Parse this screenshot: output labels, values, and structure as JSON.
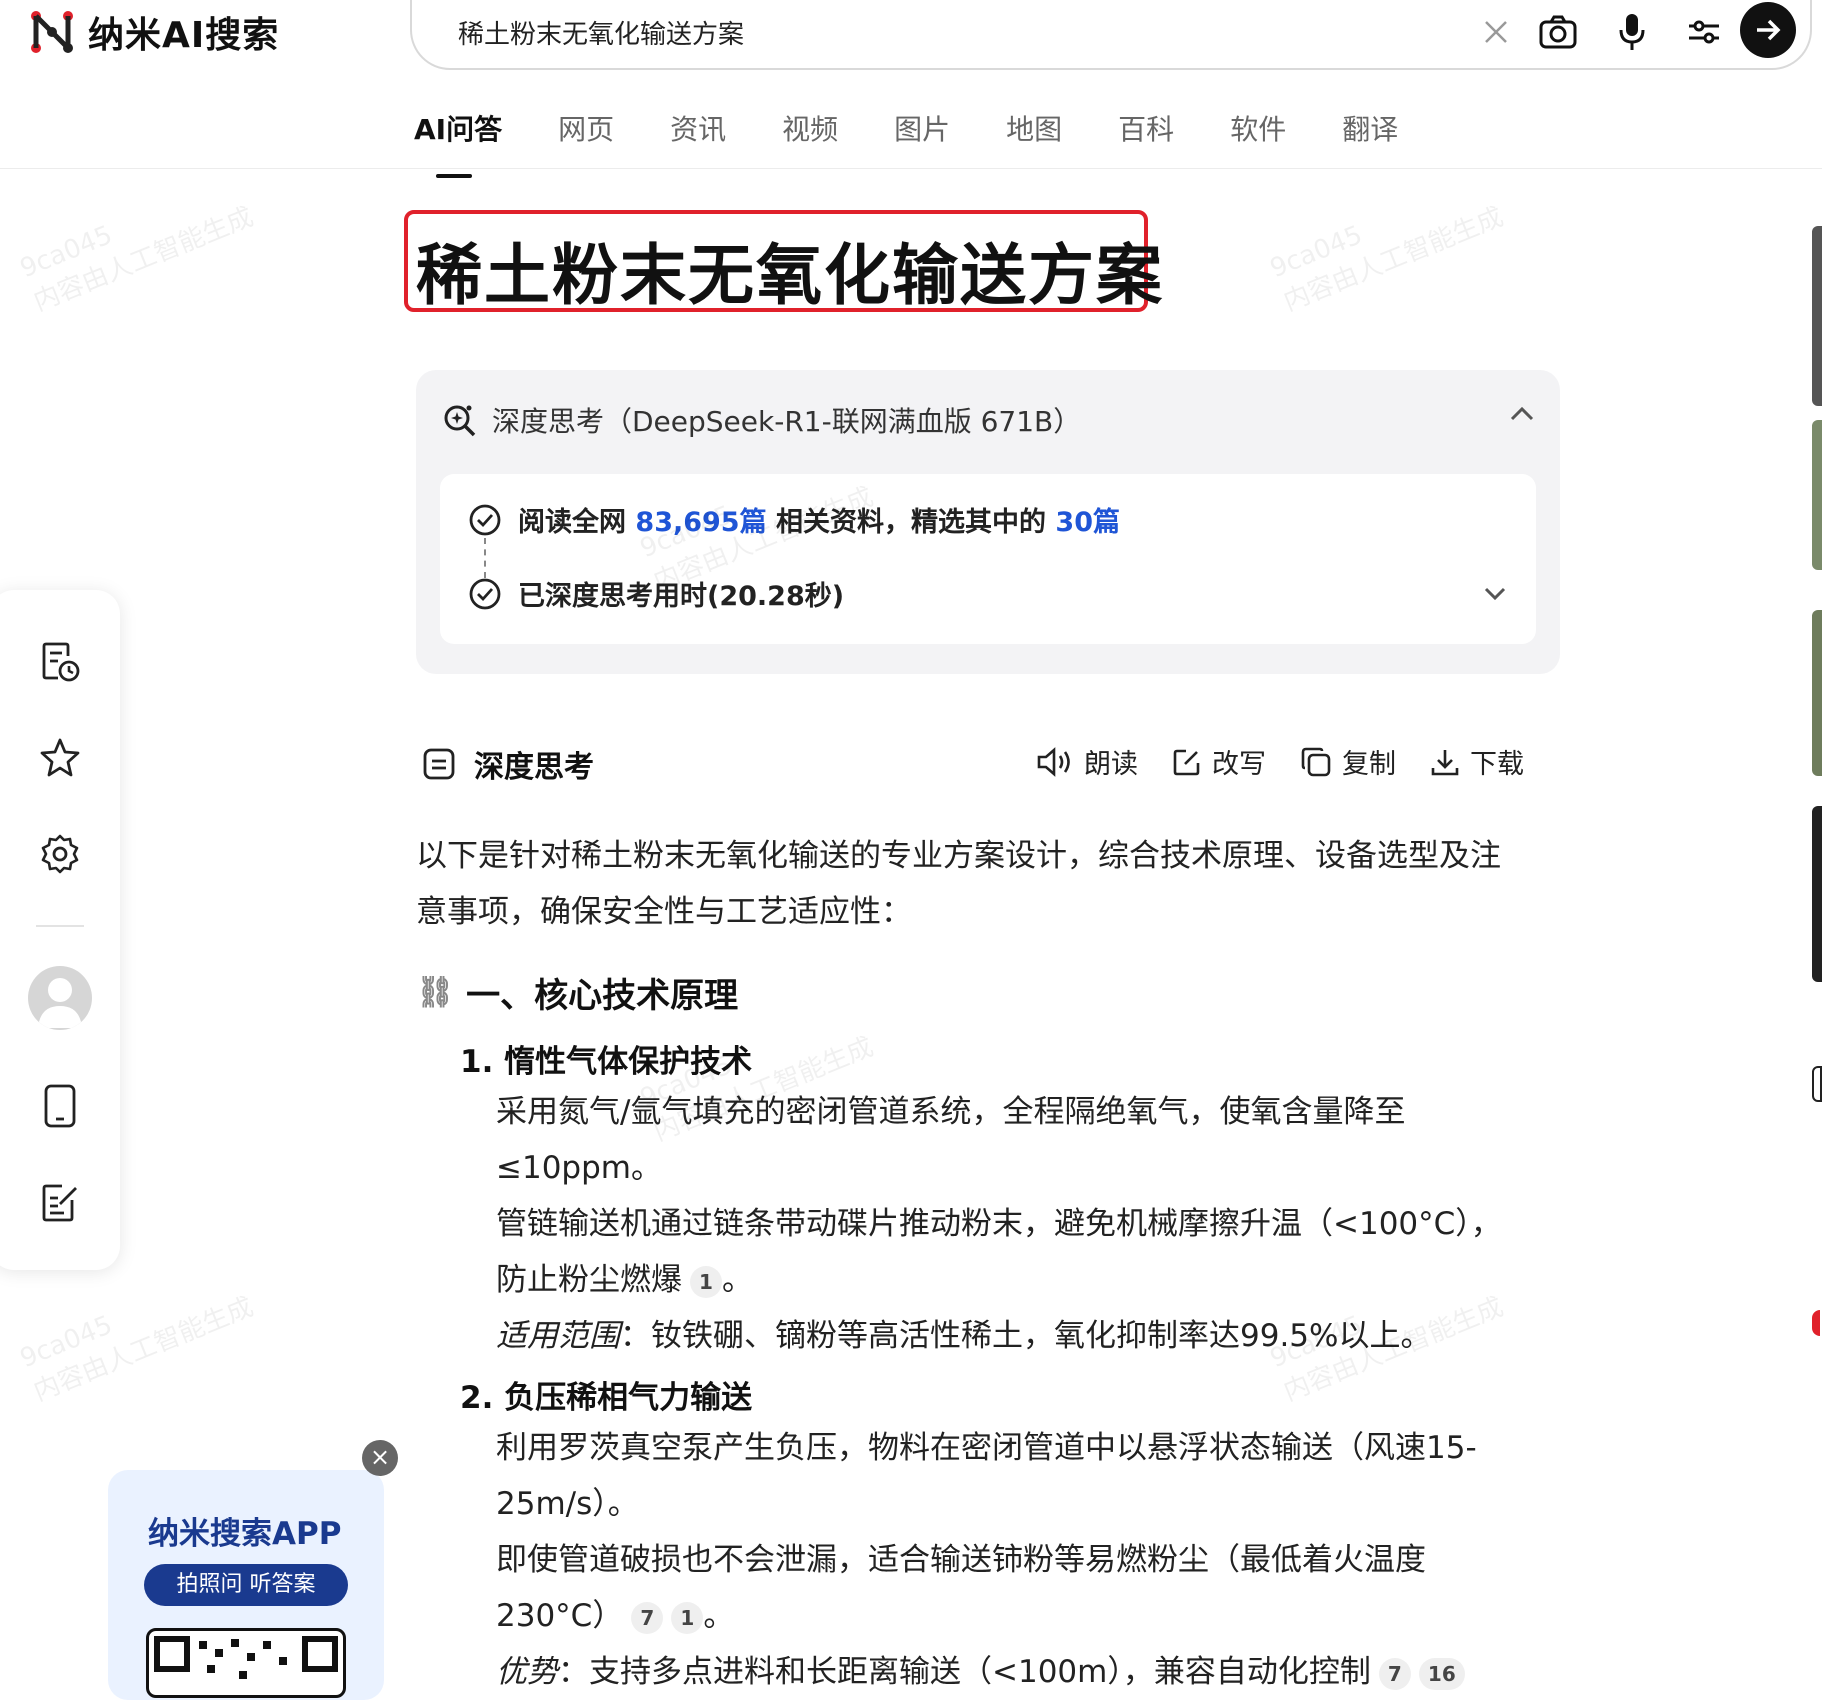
{
  "header": {
    "logo_text": "纳米AI搜索",
    "search_value": "稀土粉末无氧化输送方案",
    "icons": [
      "close-icon",
      "camera-icon",
      "microphone-icon",
      "filter-icon",
      "arrow-right-icon"
    ]
  },
  "tabs": [
    "AI问答",
    "网页",
    "资讯",
    "视频",
    "图片",
    "地图",
    "百科",
    "软件",
    "翻译"
  ],
  "title": "稀土粉末无氧化输送方案",
  "think": {
    "label": "深度思考（DeepSeek-R1-联网满血版 671B）",
    "read_prefix": "阅读全网 ",
    "read_count": "83,695篇",
    "read_mid": " 相关资料，精选其中的 ",
    "read_selected": "30篇",
    "time_text": "已深度思考用时(20.28秒)"
  },
  "section": {
    "title": "深度思考",
    "actions": [
      "朗读",
      "改写",
      "复制",
      "下载"
    ]
  },
  "content": {
    "intro_1": "以下是针对稀土粉末无氧化输送的专业方案设计，综合技术原理、设备选型及注",
    "intro_2": "意事项，确保安全性与工艺适应性：",
    "h2": "一、核心技术原理",
    "h2_emoji": "⛓",
    "item1_title": "1. 惰性气体保护技术",
    "item1_p1a": "采用氮气/氩气填充的密闭管道系统，全程隔绝氧气，使氧含量降至",
    "item1_p1b": "≤10ppm。",
    "item1_p2a": "管链输送机通过链条带动碟片推动粉末，避免机械摩擦升温（<100°C），",
    "item1_p2b": "防止粉尘燃爆",
    "item1_p2b_end": "。",
    "item1_scope_label": "适用范围",
    "item1_scope_text": "：钕铁硼、镝粉等高活性稀土，氧化抑制率达99.5%以上。",
    "item2_title": "2. 负压稀相气力输送",
    "item2_p1a": "利用罗茨真空泵产生负压，物料在密闭管道中以悬浮状态输送（风速15-",
    "item2_p1b": "25m/s）。",
    "item2_p2a": "即使管道破损也不会泄漏，适合输送铈粉等易燃粉尘（最低着火温度",
    "item2_p2b": "230°C）",
    "item2_p2b_end": "。",
    "item2_adv_label": "优势",
    "item2_adv_text": "：支持多点进料和长距离输送（<100m），兼容自动化控制",
    "citations": {
      "c1": "1",
      "c7": "7",
      "c1b": "1",
      "c7b": "7",
      "c16": "16"
    }
  },
  "promo": {
    "title": "纳米搜索APP",
    "pill": "拍照问 听答案",
    "close": "×"
  },
  "watermark": {
    "line1": "9ca045",
    "line2": "内容由人工智能生成"
  }
}
